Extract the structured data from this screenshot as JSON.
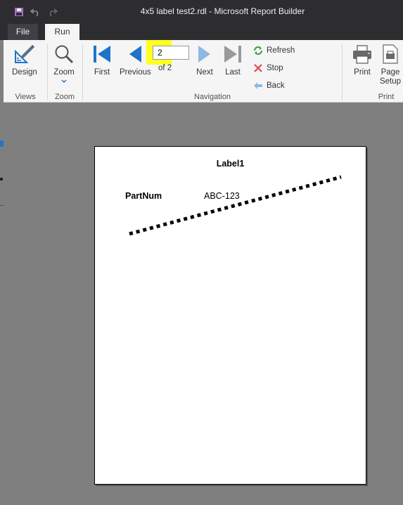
{
  "window": {
    "title": "4x5 label test2.rdl - Microsoft Report Builder"
  },
  "tabs": {
    "file": "File",
    "run": "Run"
  },
  "ribbon": {
    "views": {
      "design": "Design",
      "group_label": "Views"
    },
    "zoom": {
      "zoom": "Zoom",
      "group_label": "Zoom"
    },
    "navigation": {
      "first": "First",
      "previous": "Previous",
      "current_page": "2",
      "of_text": "of  2",
      "next": "Next",
      "last": "Last",
      "refresh": "Refresh",
      "stop": "Stop",
      "back": "Back",
      "group_label": "Navigation"
    },
    "print": {
      "print": "Print",
      "page_setup_line1": "Page",
      "page_setup_line2": "Setup",
      "group_label": "Print"
    }
  },
  "report": {
    "title": "Label1",
    "partnum_label": "PartNum",
    "partnum_value": "ABC-123"
  },
  "colors": {
    "accent_blue": "#1f73c8",
    "highlight": "#ffff20",
    "dark_chrome": "#2d2d30",
    "ribbon_bg": "#f5f5f5",
    "canvas": "#7f7f7f"
  },
  "icons": [
    "save-icon",
    "undo-icon",
    "redo-icon",
    "design-icon",
    "zoom-icon",
    "first-icon",
    "previous-icon",
    "next-icon",
    "last-icon",
    "refresh-icon",
    "stop-icon",
    "back-icon",
    "print-icon",
    "page-setup-icon"
  ]
}
